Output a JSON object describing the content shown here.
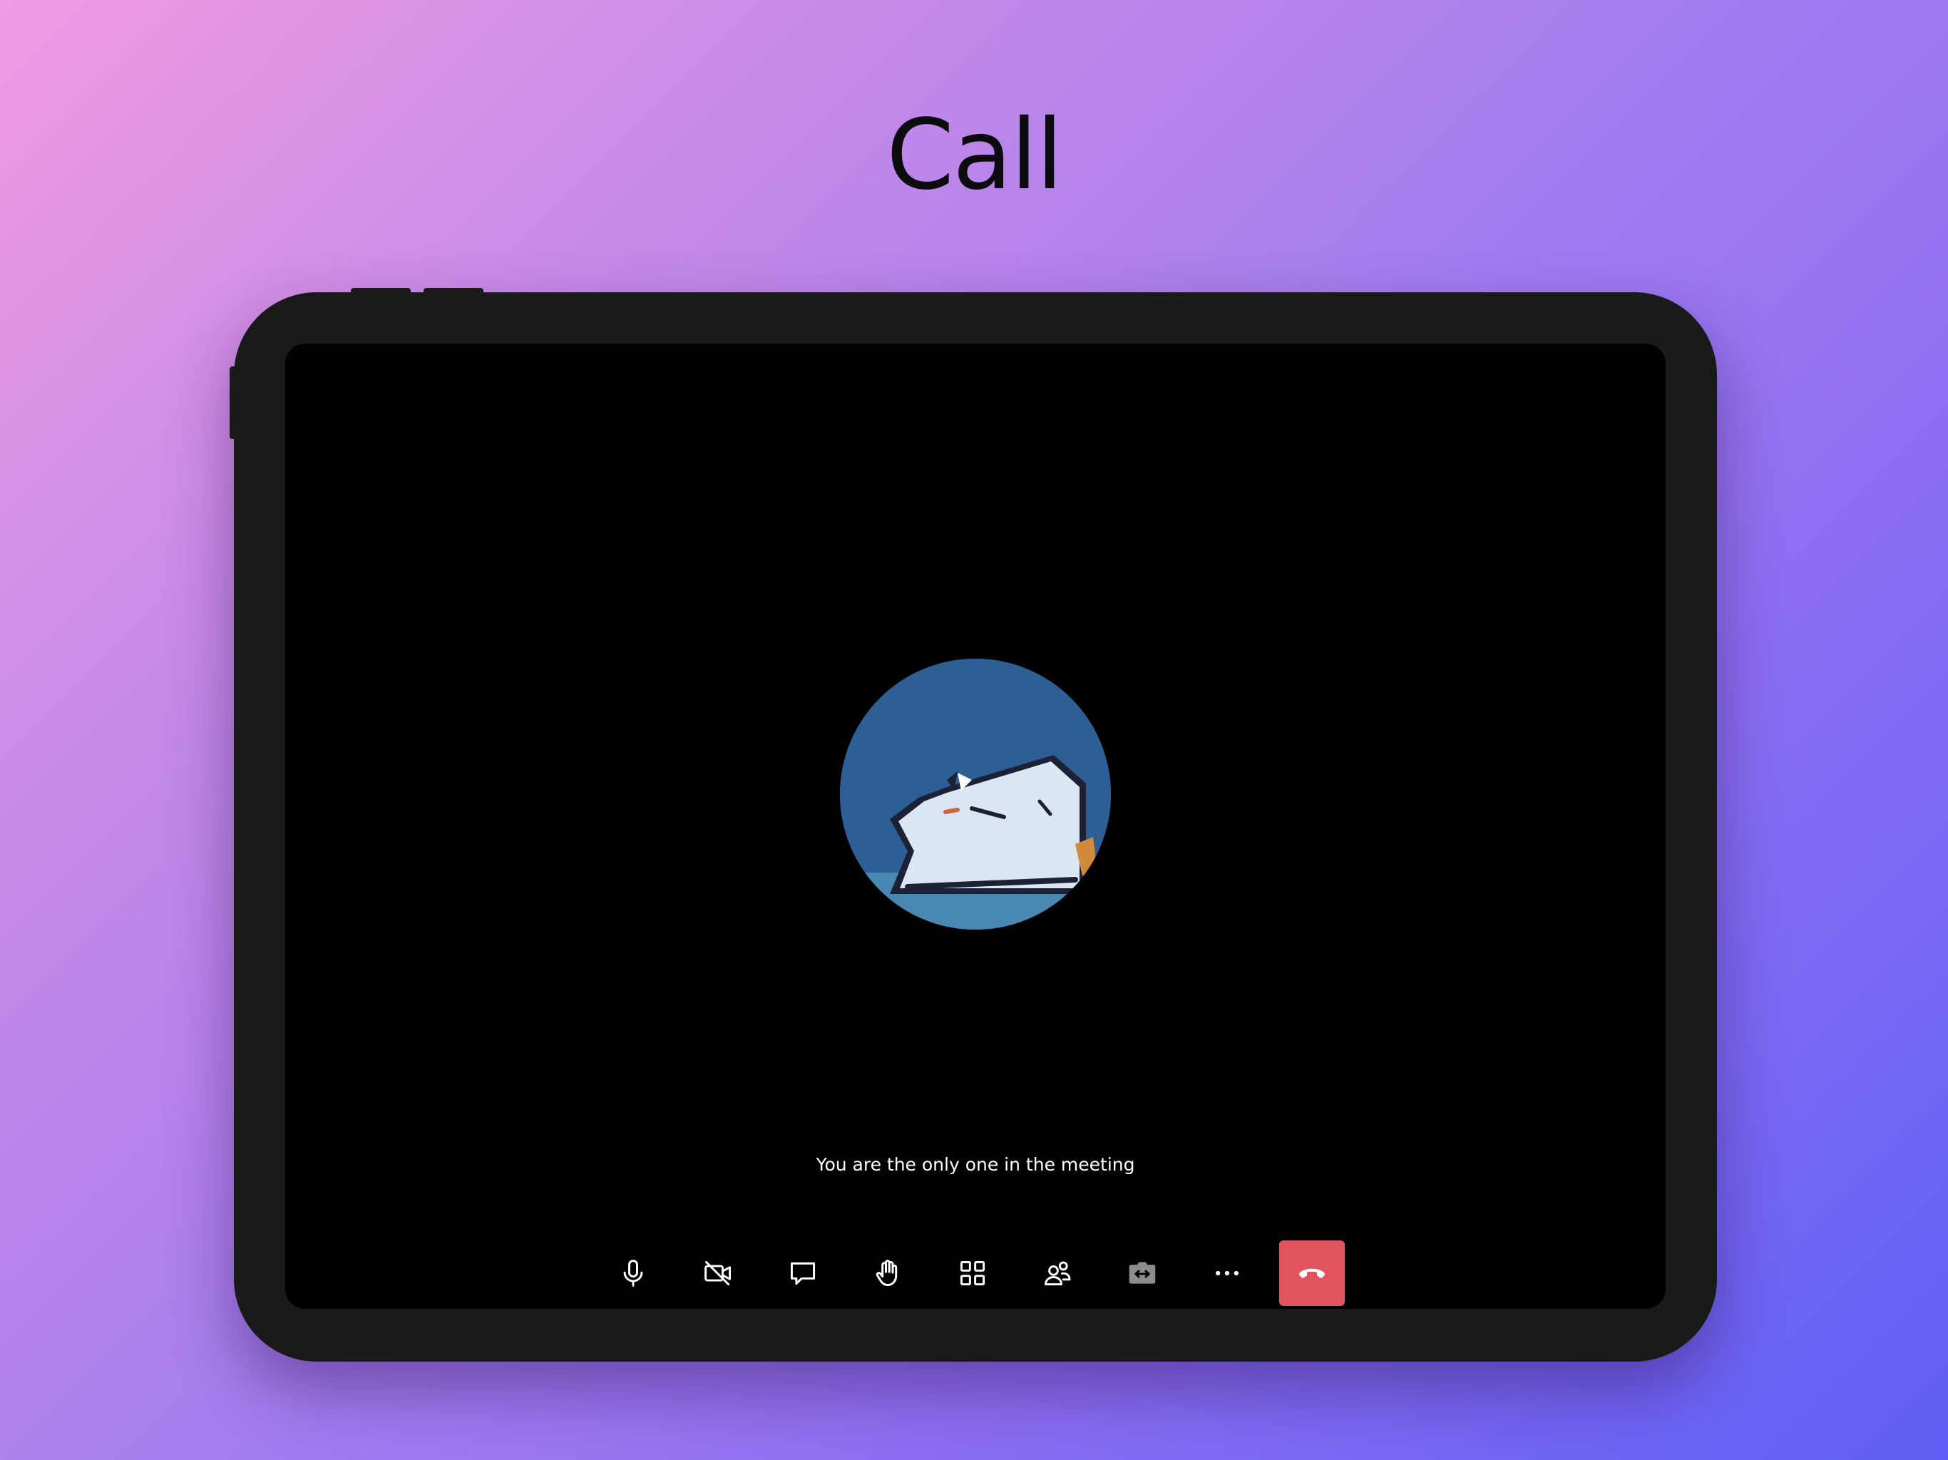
{
  "page": {
    "title": "Call"
  },
  "call": {
    "status_text": "You are the only one in the meeting",
    "avatar_icon": "user-avatar-cartoon"
  },
  "toolbar": {
    "buttons": [
      {
        "name": "microphone",
        "icon": "microphone-icon"
      },
      {
        "name": "camera-off",
        "icon": "video-off-icon"
      },
      {
        "name": "chat",
        "icon": "chat-bubble-icon"
      },
      {
        "name": "raise-hand",
        "icon": "hand-icon"
      },
      {
        "name": "layout",
        "icon": "grid-icon"
      },
      {
        "name": "participants",
        "icon": "people-icon"
      },
      {
        "name": "switch-camera",
        "icon": "camera-switch-icon"
      },
      {
        "name": "more",
        "icon": "more-dots-icon"
      },
      {
        "name": "end-call",
        "icon": "hang-up-icon"
      }
    ]
  },
  "colors": {
    "end_call": "#e2545d",
    "screen_bg": "#000000",
    "device_frame": "#1a1a1a"
  }
}
